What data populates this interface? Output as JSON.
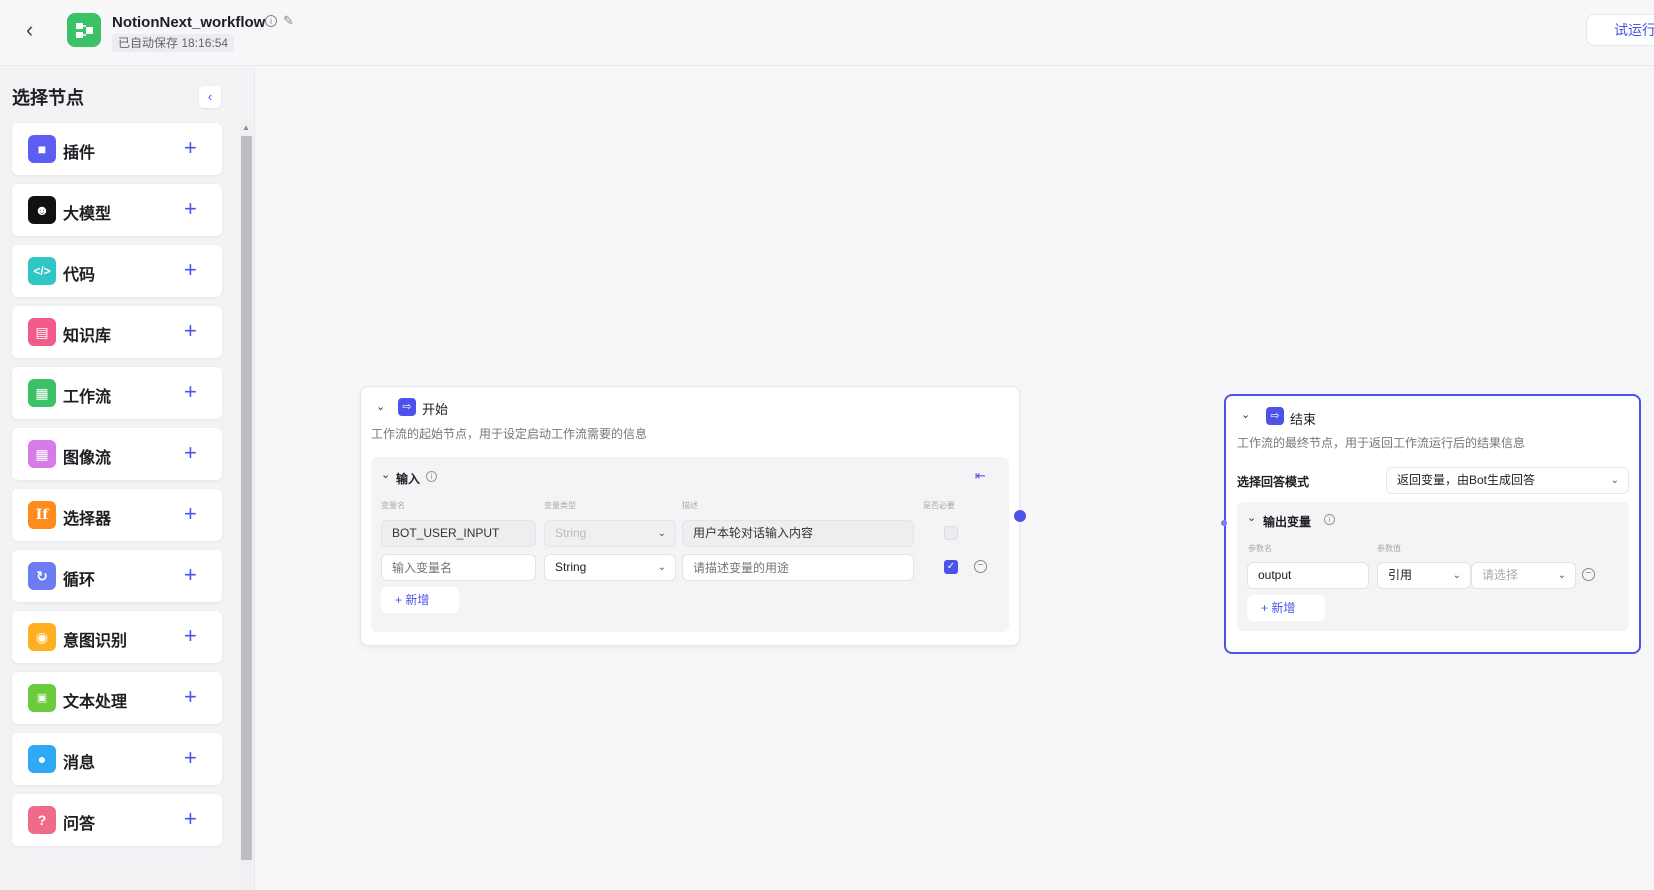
{
  "header": {
    "title": "NotionNext_workflow",
    "save_status": "已自动保存 18:16:54",
    "run_button": "试运行"
  },
  "sidebar": {
    "title": "选择节点",
    "items": [
      {
        "label": "插件",
        "icon": "cube-icon",
        "color": "#5b5ef0"
      },
      {
        "label": "大模型",
        "icon": "llm-face-icon",
        "color": "#111111"
      },
      {
        "label": "代码",
        "icon": "code-icon",
        "color": "#2fc6c6"
      },
      {
        "label": "知识库",
        "icon": "book-icon",
        "color": "#f05b8a"
      },
      {
        "label": "工作流",
        "icon": "workflow-icon",
        "color": "#3cc266"
      },
      {
        "label": "图像流",
        "icon": "imageflow-icon",
        "color": "#d77be8"
      },
      {
        "label": "选择器",
        "icon": "if-icon",
        "color": "#ff8c1a"
      },
      {
        "label": "循环",
        "icon": "loop-icon",
        "color": "#6b7cf5"
      },
      {
        "label": "意图识别",
        "icon": "intent-icon",
        "color": "#ffb020"
      },
      {
        "label": "文本处理",
        "icon": "text-process-icon",
        "color": "#6ccb3d"
      },
      {
        "label": "消息",
        "icon": "message-icon",
        "color": "#2fa8f5"
      },
      {
        "label": "问答",
        "icon": "qa-icon",
        "color": "#f06a8a"
      }
    ]
  },
  "start_node": {
    "title": "开始",
    "description": "工作流的起始节点，用于设定启动工作流需要的信息",
    "input_section": {
      "title": "输入",
      "columns": [
        "变量名",
        "变量类型",
        "描述",
        "是否必要"
      ],
      "rows": [
        {
          "name": "BOT_USER_INPUT",
          "type": "String",
          "description": "用户本轮对话输入内容",
          "required": false,
          "disabled": true
        },
        {
          "name_placeholder": "输入变量名",
          "type": "String",
          "description_placeholder": "请描述变量的用途",
          "required": true,
          "disabled": false
        }
      ],
      "add_label": "新增"
    }
  },
  "end_node": {
    "title": "结束",
    "description": "工作流的最终节点，用于返回工作流运行后的结果信息",
    "answer_mode_label": "选择回答模式",
    "answer_mode_value": "返回变量，由Bot生成回答",
    "output_section": {
      "title": "输出变量",
      "columns": [
        "参数名",
        "参数值"
      ],
      "rows": [
        {
          "name": "output",
          "ref_type": "引用",
          "value_placeholder": "请选择"
        }
      ],
      "add_label": "新增"
    }
  },
  "colors": {
    "accent": "#4d53e8",
    "canvas_bg": "#f7f7fa"
  }
}
